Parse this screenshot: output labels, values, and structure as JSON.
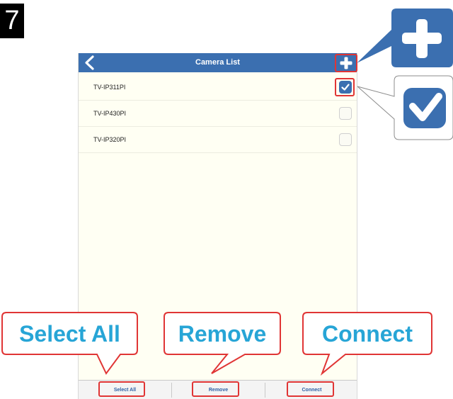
{
  "step": {
    "number": "7"
  },
  "titlebar": {
    "title": "Camera List",
    "back_icon": "chevron-left-icon",
    "add_icon": "plus-icon"
  },
  "cameras": [
    {
      "name": "TV-IP311PI",
      "checked": true
    },
    {
      "name": "TV-IP430PI",
      "checked": false
    },
    {
      "name": "TV-IP320PI",
      "checked": false
    }
  ],
  "bottombar": {
    "select_all": "Select All",
    "remove": "Remove",
    "connect": "Connect"
  },
  "callouts": {
    "select_all": "Select All",
    "remove": "Remove",
    "connect": "Connect",
    "zoom_plus_icon": "plus-icon",
    "zoom_check_icon": "checkbox-checked-icon"
  },
  "colors": {
    "titlebar": "#3b6fb0",
    "highlight": "#e03535",
    "callout_text": "#27a5d6",
    "content_bg": "#fffff3"
  }
}
